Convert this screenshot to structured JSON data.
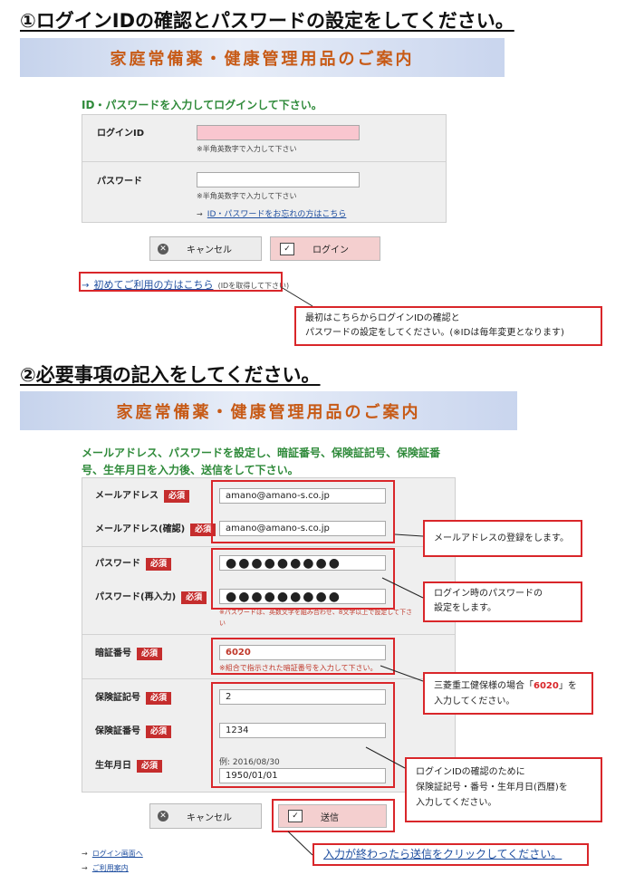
{
  "step1": {
    "title": "①ログインIDの確認とパスワードの設定をしてください。",
    "banner": "家庭常備薬・健康管理用品のご案内",
    "instruction": "ID・パスワードを入力してログインして下さい。",
    "login_id": {
      "label": "ログインID",
      "value": "",
      "note": "※半角英数字で入力して下さい"
    },
    "password": {
      "label": "パスワード",
      "value": "",
      "note": "※半角英数字で入力して下さい"
    },
    "forgot_arrow": "→",
    "forgot_link": "ID・パスワードをお忘れの方はこちら",
    "cancel_label": "キャンセル",
    "login_label": "ログイン",
    "first_time_arrow": "→",
    "first_time_link": "初めてご利用の方はこちら",
    "first_time_note": "(IDを取得して下さい)",
    "callout_line1": "最初はこちらからログインIDの確認と",
    "callout_line2": "パスワードの設定をしてください。(※IDは毎年変更となります)"
  },
  "step2": {
    "title": "②必要事項の記入をしてください。",
    "banner": "家庭常備薬・健康管理用品のご案内",
    "instruction_line1": "メールアドレス、パスワードを設定し、暗証番号、保険証記号、保険証番",
    "instruction_line2": "号、生年月日を入力後、送信をして下さい。",
    "required": "必須",
    "email": {
      "label": "メールアドレス",
      "value": "amano@amano-s.co.jp"
    },
    "email_confirm": {
      "label": "メールアドレス(確認)",
      "value": "amano@amano-s.co.jp"
    },
    "password": {
      "label": "パスワード",
      "value": "●●●●●●●●●"
    },
    "password_confirm": {
      "label": "パスワード(再入力)",
      "value": "●●●●●●●●●"
    },
    "password_note": "※パスワードは、英数文字を組み合わせ、8文字以上で設定して下さ",
    "password_note2": "い",
    "pin": {
      "label": "暗証番号",
      "value": "6020",
      "note": "※組合で指示された暗証番号を入力して下さい。"
    },
    "insurance_symbol": {
      "label": "保険証記号",
      "value": "2"
    },
    "insurance_number": {
      "label": "保険証番号",
      "value": "1234"
    },
    "birthday": {
      "label": "生年月日",
      "example": "例: 2016/08/30",
      "value": "1950/01/01"
    },
    "cancel_label": "キャンセル",
    "send_label": "送信",
    "nav_arrow": "→",
    "guide_link": "ログイン画面へ",
    "usage_link": "ご利用案内",
    "callout_email": "メールアドレスの登録をします。",
    "callout_pw_line1": "ログイン時のパスワードの",
    "callout_pw_line2": "設定をします。",
    "callout_pin_pre": "三菱重工健保様の場合「",
    "callout_pin_code": "6020",
    "callout_pin_post": "」を",
    "callout_pin_line2": "入力してください。",
    "callout_ins_line1": "ログインIDの確認のために",
    "callout_ins_line2": "保険証記号・番号・生年月日(西暦)を",
    "callout_ins_line3": "入力してください。",
    "callout_send": "入力が終わったら送信をクリックしてください。"
  },
  "colors": {
    "accent_red": "#d9262a",
    "instruction_green": "#2f8a3a",
    "banner_text": "#c75a16"
  }
}
